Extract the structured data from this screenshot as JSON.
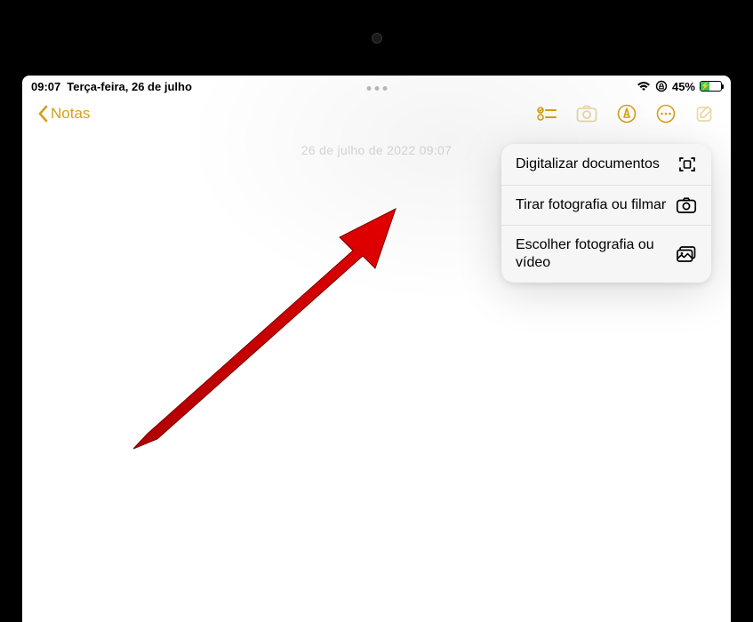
{
  "status": {
    "time": "09:07",
    "date": "Terça-feira, 26 de julho",
    "battery_pct": "45%"
  },
  "toolbar": {
    "back_label": "Notas"
  },
  "note": {
    "timestamp": "26 de julho de 2022 09:07"
  },
  "popup": {
    "scan_label": "Digitalizar documentos",
    "photo_label": "Tirar fotografia ou filmar",
    "choose_label": "Escolher fotografia ou vídeo"
  }
}
